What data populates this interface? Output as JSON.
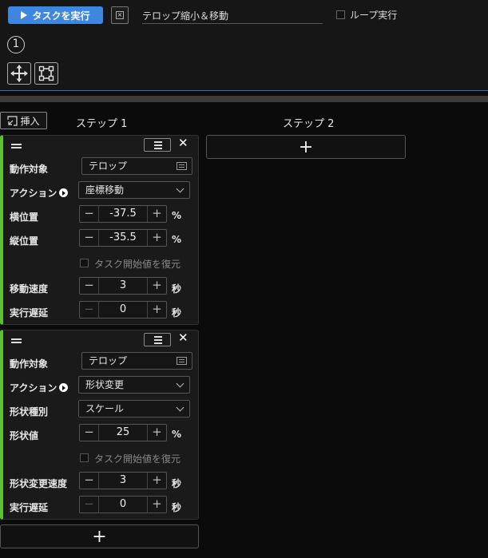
{
  "toolbar": {
    "run_label": "タスクを実行",
    "task_name": "テロップ縮小＆移動",
    "loop_label": "ループ実行",
    "step_number": "①"
  },
  "steps": {
    "insert_label": "挿入",
    "step1_label": "ステップ 1",
    "step2_label": "ステップ 2",
    "add_symbol": "+"
  },
  "card1": {
    "target_label": "動作対象",
    "target_value": "テロップ",
    "action_label": "アクション",
    "action_value": "座標移動",
    "x_label": "横位置",
    "x_value": "-37.5",
    "x_unit": "%",
    "y_label": "縦位置",
    "y_value": "-35.5",
    "y_unit": "%",
    "restore_label": "タスク開始値を復元",
    "speed_label": "移動速度",
    "speed_value": "3",
    "speed_unit": "秒",
    "delay_label": "実行遅延",
    "delay_value": "0",
    "delay_unit": "秒"
  },
  "card2": {
    "target_label": "動作対象",
    "target_value": "テロップ",
    "action_label": "アクション",
    "action_value": "形状変更",
    "shape_type_label": "形状種別",
    "shape_type_value": "スケール",
    "shape_value_label": "形状値",
    "shape_value": "25",
    "shape_unit": "%",
    "restore_label": "タスク開始値を復元",
    "speed_label": "形状変更速度",
    "speed_value": "3",
    "speed_unit": "秒",
    "delay_label": "実行遅延",
    "delay_value": "0",
    "delay_unit": "秒"
  },
  "colors": {
    "accent": "#3d87e0",
    "card_stripe": "#5fbf34"
  }
}
